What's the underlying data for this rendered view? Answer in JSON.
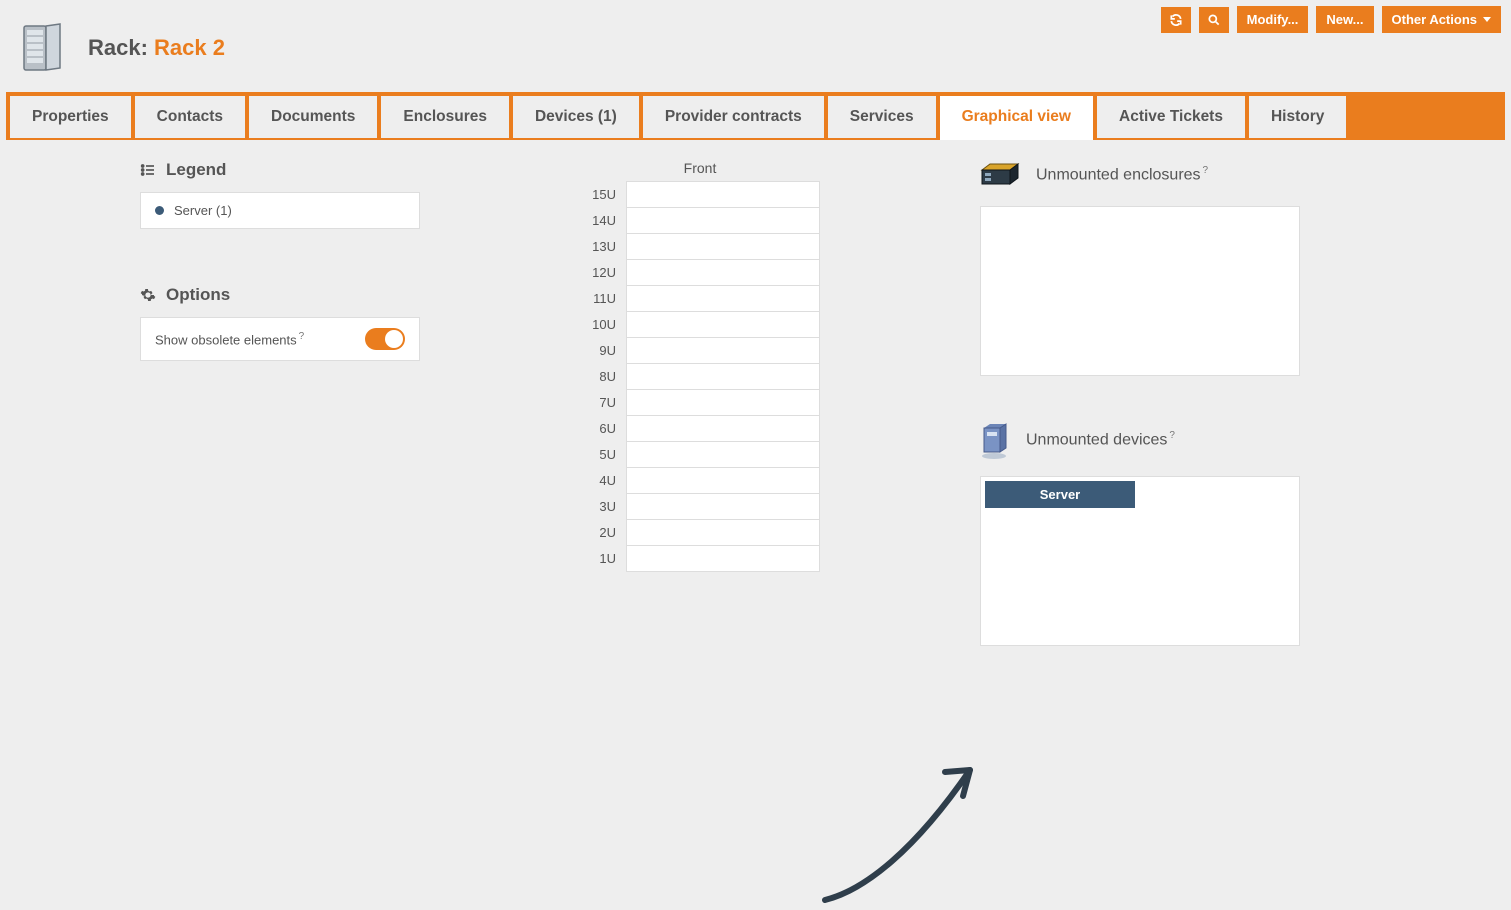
{
  "toolbar": {
    "modify_label": "Modify...",
    "new_label": "New...",
    "other_actions_label": "Other Actions"
  },
  "header": {
    "label": "Rack:",
    "name": "Rack 2"
  },
  "tabs": [
    {
      "id": "properties",
      "label": "Properties",
      "active": false
    },
    {
      "id": "contacts",
      "label": "Contacts",
      "active": false
    },
    {
      "id": "documents",
      "label": "Documents",
      "active": false
    },
    {
      "id": "enclosures",
      "label": "Enclosures",
      "active": false
    },
    {
      "id": "devices",
      "label": "Devices (1)",
      "active": false
    },
    {
      "id": "provider",
      "label": "Provider contracts",
      "active": false
    },
    {
      "id": "services",
      "label": "Services",
      "active": false
    },
    {
      "id": "graphical",
      "label": "Graphical view",
      "active": true
    },
    {
      "id": "tickets",
      "label": "Active Tickets",
      "active": false
    },
    {
      "id": "history",
      "label": "History",
      "active": false
    }
  ],
  "legend": {
    "title": "Legend",
    "items": [
      {
        "label": "Server (1)",
        "color": "#3c5b78"
      }
    ]
  },
  "options": {
    "title": "Options",
    "show_obsolete_label": "Show obsolete elements",
    "show_obsolete_on": true
  },
  "rack_view": {
    "title": "Front",
    "units": 15
  },
  "unmounted": {
    "enclosures_title": "Unmounted enclosures",
    "devices_title": "Unmounted devices",
    "devices": [
      {
        "label": "Server"
      }
    ]
  },
  "help_marker": "?"
}
